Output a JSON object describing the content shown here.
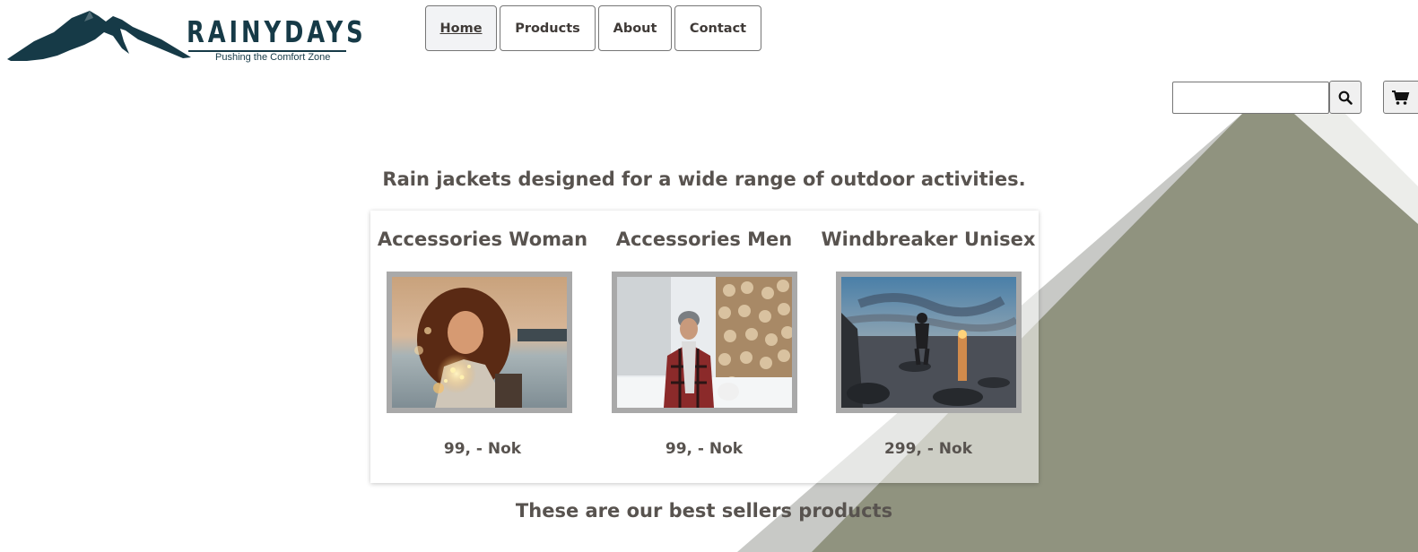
{
  "brand": {
    "name": "RAINYDAYS",
    "tagline": "Pushing the Comfort Zone",
    "color": "#163a47"
  },
  "nav": {
    "items": [
      {
        "label": "Home",
        "active": true
      },
      {
        "label": "Products",
        "active": false
      },
      {
        "label": "About",
        "active": false
      },
      {
        "label": "Contact",
        "active": false
      }
    ]
  },
  "search": {
    "value": "",
    "button_icon": "search-icon",
    "cart_icon": "cart-icon"
  },
  "main": {
    "headline": "Rain jackets designed for a wide range of outdoor activities.",
    "products": [
      {
        "title": "Accessories Woman",
        "price": "99, - Nok",
        "image": "woman-with-fairy-lights"
      },
      {
        "title": "Accessories Men",
        "price": "99, - Nok",
        "image": "man-in-snow-by-firewood"
      },
      {
        "title": "Windbreaker Unisex",
        "price": "299, - Nok",
        "image": "person-on-rocks-at-sunset"
      }
    ],
    "subheadline": "These are our best sellers products"
  },
  "colors": {
    "text": "#58534f",
    "background_shape": "#8e9181"
  }
}
